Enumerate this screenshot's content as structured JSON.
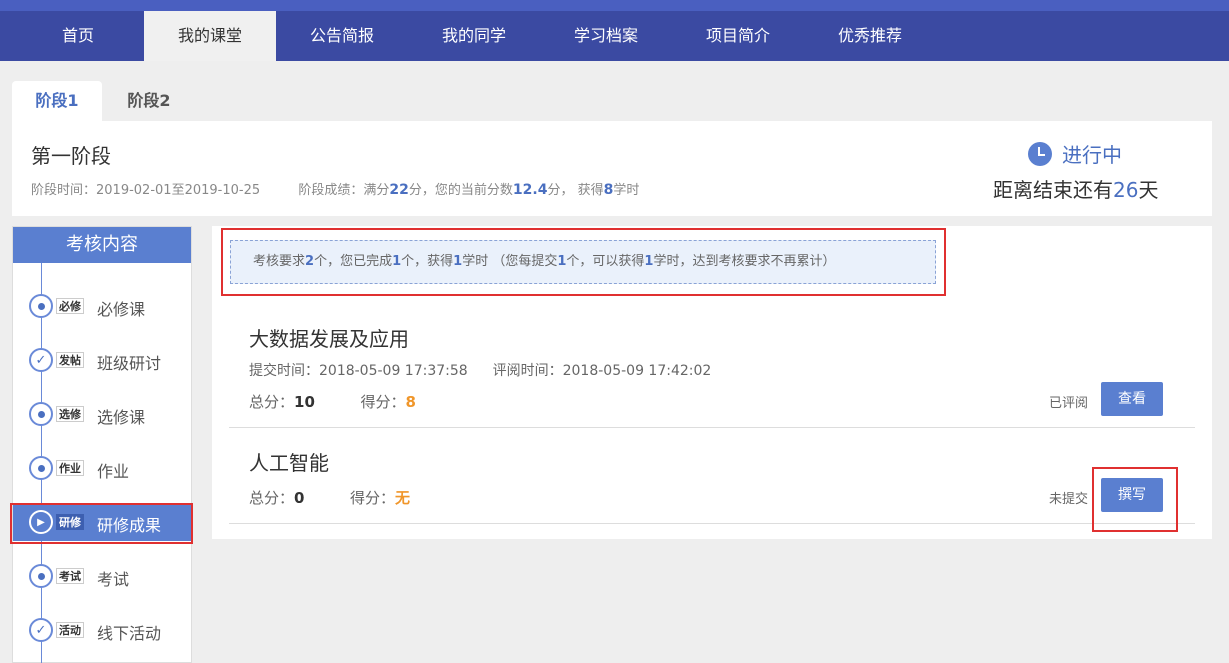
{
  "nav": {
    "items": [
      "首页",
      "我的课堂",
      "公告简报",
      "我的同学",
      "学习档案",
      "项目简介",
      "优秀推荐"
    ],
    "active": "我的课堂"
  },
  "stage_tabs": [
    "阶段1",
    "阶段2"
  ],
  "stage": {
    "title": "第一阶段",
    "time_label": "阶段时间：",
    "time_value": "2019-02-01至2019-10-25",
    "score_label": "阶段成绩：满分",
    "full_score": "22",
    "score_mid": "分，您的当前分数",
    "current_score": "12.4",
    "score_mid2": "分，  获得",
    "hours": "8",
    "score_end": "学时",
    "status": "进行中",
    "countdown_prefix": "距离结束还有",
    "countdown_days": "26",
    "countdown_suffix": "天"
  },
  "sidebar": {
    "title": "考核内容",
    "items": [
      {
        "tag": "必修",
        "label": "必修课",
        "icon": "dot"
      },
      {
        "tag": "发帖",
        "label": "班级研讨",
        "icon": "check"
      },
      {
        "tag": "选修",
        "label": "选修课",
        "icon": "dot"
      },
      {
        "tag": "作业",
        "label": "作业",
        "icon": "dot"
      },
      {
        "tag": "研修",
        "label": "研修成果",
        "icon": "play"
      },
      {
        "tag": "考试",
        "label": "考试",
        "icon": "dot"
      },
      {
        "tag": "活动",
        "label": "线下活动",
        "icon": "check"
      }
    ]
  },
  "requirement": {
    "p1": "考核要求",
    "n1": "2",
    "p2": "个，您已完成",
    "n2": "1",
    "p3": "个，获得",
    "n3": "1",
    "p4": "学时 （您每提交",
    "n4": "1",
    "p5": "个，可以获得",
    "n5": "1",
    "p6": "学时，达到考核要求不再累计）"
  },
  "works": [
    {
      "title": "大数据发展及应用",
      "submit_label": "提交时间：",
      "submit_time": "2018-05-09 17:37:58",
      "review_label": "评阅时间：",
      "review_time": "2018-05-09 17:42:02",
      "total_label": "总分：",
      "total": "10",
      "score_label": "得分：",
      "score": "8",
      "state": "已评阅",
      "button": "查看"
    },
    {
      "title": "人工智能",
      "total_label": "总分：",
      "total": "0",
      "score_label": "得分：",
      "score": "无",
      "state": "未提交",
      "button": "撰写"
    }
  ],
  "colors": {
    "accent": "#5a7fd0",
    "nav_bg": "#3b4aa2",
    "highlight": "#e03030",
    "score": "#f0962a"
  }
}
